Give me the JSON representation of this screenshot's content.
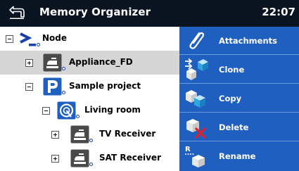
{
  "header": {
    "title": "Memory Organizer",
    "time": "22:07"
  },
  "tree": {
    "nodes": [
      {
        "label": "Node",
        "expander": "minus",
        "icon": "node-prompt-icon"
      },
      {
        "label": "Appliance_FD",
        "expander": "plus",
        "icon": "appliance-icon",
        "selected": true
      },
      {
        "label": "Sample project",
        "expander": "minus",
        "icon": "project-icon"
      },
      {
        "label": "Living room",
        "expander": "minus",
        "icon": "room-icon"
      },
      {
        "label": "TV Receiver",
        "expander": "plus",
        "icon": "appliance-icon"
      },
      {
        "label": "SAT Receiver",
        "expander": "plus",
        "icon": "appliance-icon"
      }
    ]
  },
  "actions": {
    "items": [
      {
        "label": "Attachments",
        "icon": "paperclip-icon"
      },
      {
        "label": "Clone",
        "icon": "clone-icon"
      },
      {
        "label": "Copy",
        "icon": "copy-icon"
      },
      {
        "label": "Delete",
        "icon": "delete-icon"
      },
      {
        "label": "Rename",
        "icon": "rename-icon"
      }
    ]
  },
  "colors": {
    "titlebar": "#0a1320",
    "actions_panel": "#1f5fbf",
    "selection": "#d6d6d6",
    "icon_accent": "#2fa6e0",
    "delete_red": "#e0202a"
  }
}
